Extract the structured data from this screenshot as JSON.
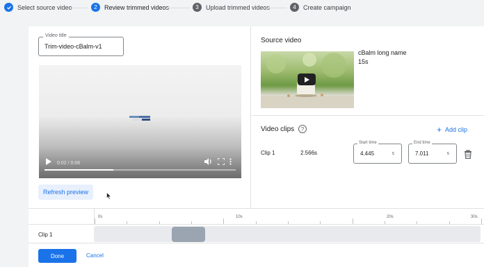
{
  "stepper": {
    "steps": [
      {
        "label": "Select source video",
        "marker": "check-icon",
        "state": "complete"
      },
      {
        "label": "Review trimmed videos",
        "marker": "2",
        "state": "active"
      },
      {
        "label": "Upload trimmed videos",
        "marker": "3",
        "state": "upcoming"
      },
      {
        "label": "Create campaign",
        "marker": "4",
        "state": "upcoming"
      }
    ]
  },
  "editor": {
    "title_legend": "Video title",
    "title_value": "Trim-video-cBalm-v1",
    "player": {
      "timecode": "0:02 / 0:06",
      "progress_fraction": 0.36
    },
    "refresh_label": "Refresh preview"
  },
  "source": {
    "heading": "Source video",
    "name": "cBalm long name",
    "duration": "15s"
  },
  "clips": {
    "heading": "Video clips",
    "add_label": "Add clip",
    "rows": [
      {
        "label": "Clip 1",
        "length": "2.566s",
        "start_legend": "Start time",
        "start_value": "4.445",
        "end_legend": "End time",
        "end_value": "7.011",
        "unit": "s"
      }
    ]
  },
  "timeline": {
    "ticks": [
      "0s",
      "10s",
      "20s",
      "30s"
    ],
    "track_label": "Clip 1",
    "track_max_seconds": 30,
    "clip_start_seconds": 4.445,
    "clip_end_seconds": 7.011
  },
  "footer": {
    "done_label": "Done",
    "cancel_label": "Cancel"
  },
  "colors": {
    "accent": "#1a73e8",
    "done_bg": "#1a73e8",
    "refresh_bg": "#e8f0fe",
    "clip_block": "#9aa5b1"
  }
}
